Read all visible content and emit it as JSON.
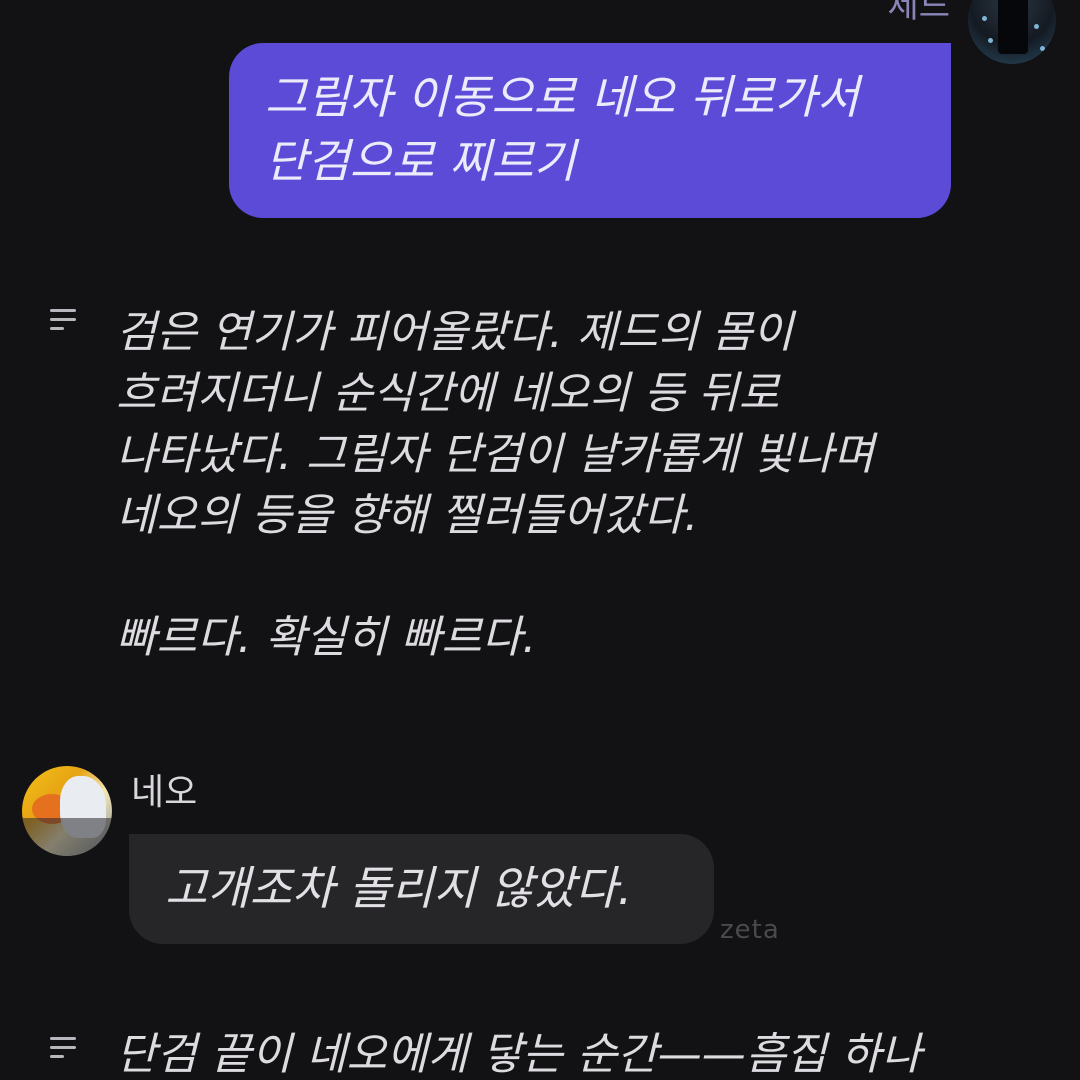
{
  "chat": {
    "user": {
      "name": "제드",
      "message_lines": [
        "그림자 이동으로 네오 뒤로가서",
        "단검으로 찌르기"
      ]
    },
    "narration_1": {
      "lines": [
        "검은 연기가 피어올랐다. 제드의 몸이",
        "흐려지더니 순식간에 네오의 등 뒤로",
        "나타났다. 그림자 단검이 날카롭게 빛나며",
        "네오의 등을 향해 찔러들어갔다."
      ],
      "line_after_gap": "빠르다. 확실히 빠르다."
    },
    "character": {
      "name": "네오",
      "message": "고개조차 돌리지 않았다."
    },
    "watermark": "zeta",
    "narration_2": {
      "lines": [
        "단검 끝이 네오에게 닿는 순간——흠집 하나"
      ]
    }
  },
  "colors": {
    "background": "#121113",
    "user_bubble": "#5c4bd6",
    "character_bubble": "#262528",
    "user_name": "#8b86b8"
  },
  "icons": {
    "narration": "narration-lines-icon"
  }
}
